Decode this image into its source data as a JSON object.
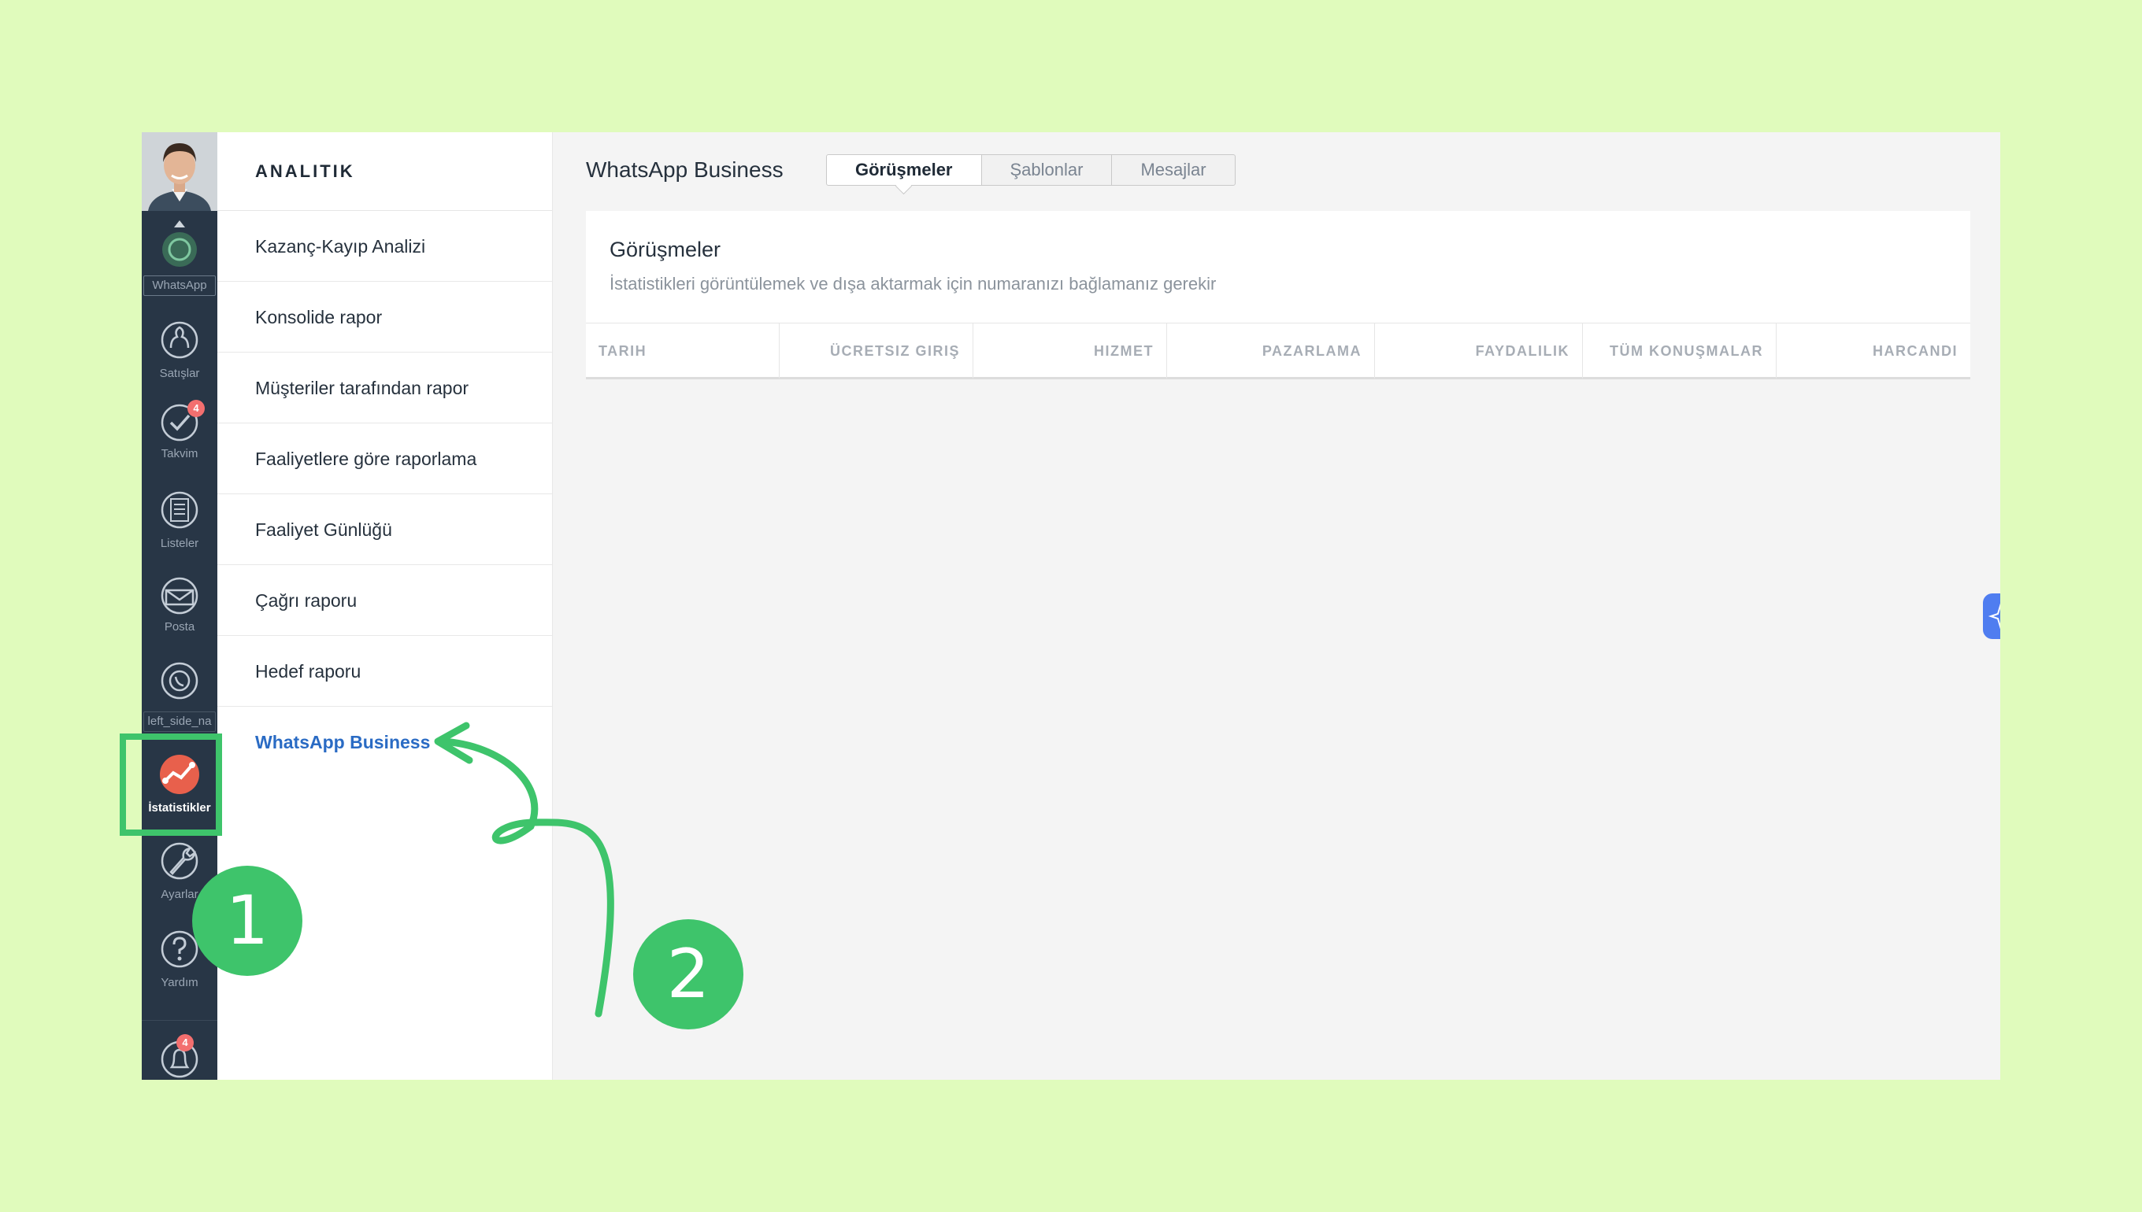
{
  "rail": {
    "items": [
      {
        "label": "WhatsApp"
      },
      {
        "label": "Satışlar"
      },
      {
        "label": "Takvim",
        "badge": "4"
      },
      {
        "label": "Listeler"
      },
      {
        "label": "Posta"
      },
      {
        "label": "left_side_na"
      },
      {
        "label": "İstatistikler",
        "active": true
      },
      {
        "label": "Ayarlar"
      },
      {
        "label": "Yardım"
      },
      {
        "label": "",
        "badge": "4"
      }
    ]
  },
  "menu": {
    "title": "ANALITIK",
    "items": [
      {
        "label": "Kazanç-Kayıp Analizi"
      },
      {
        "label": "Konsolide rapor"
      },
      {
        "label": "Müşteriler tarafından rapor"
      },
      {
        "label": "Faaliyetlere göre raporlama"
      },
      {
        "label": "Faaliyet Günlüğü"
      },
      {
        "label": "Çağrı raporu"
      },
      {
        "label": "Hedef raporu"
      },
      {
        "label": "WhatsApp Business",
        "active": true
      }
    ]
  },
  "main": {
    "title": "WhatsApp Business",
    "tabs": [
      {
        "label": "Görüşmeler",
        "active": true
      },
      {
        "label": "Şablonlar"
      },
      {
        "label": "Mesajlar"
      }
    ],
    "card": {
      "title": "Görüşmeler",
      "subtitle": "İstatistikleri görüntülemek ve dışa aktarmak için numaranızı bağlamanız gerekir",
      "columns": [
        "TARIH",
        "ÜCRETSIZ GIRIŞ",
        "HIZMET",
        "PAZARLAMA",
        "FAYDALILIK",
        "TÜM KONUŞMALAR",
        "HARCANDI"
      ]
    }
  },
  "annotations": {
    "step1": "1",
    "step2": "2"
  },
  "colors": {
    "background": "#e0fbbc",
    "rail": "#283646",
    "accent_green": "#3ec46b",
    "link_blue": "#2a6bc4",
    "badge_red": "#f36f6f",
    "analytics_icon": "#e8604c"
  }
}
